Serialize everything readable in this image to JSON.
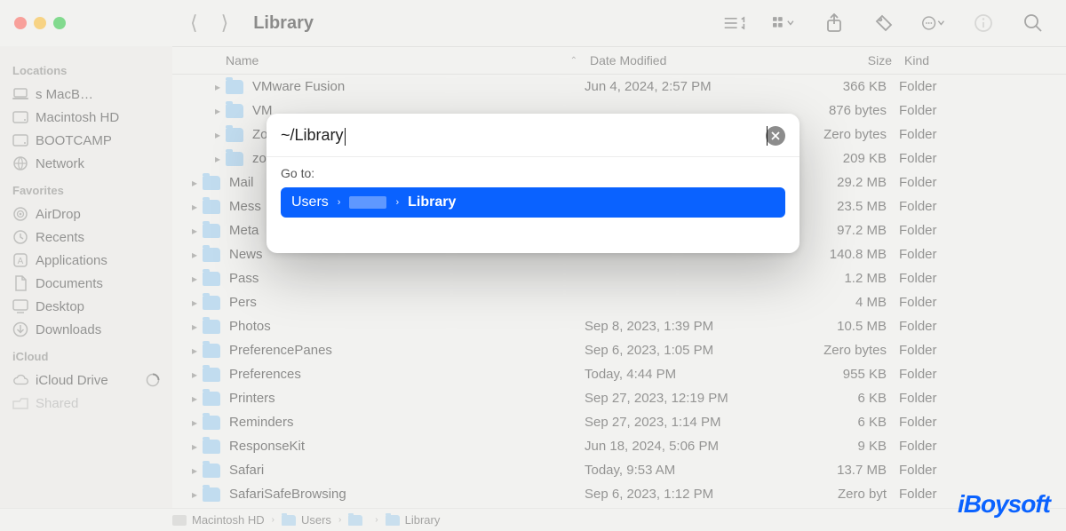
{
  "window": {
    "title": "Library"
  },
  "toolbar": {
    "back_disabled": true,
    "forward_disabled": true
  },
  "sidebar": {
    "sections": [
      {
        "label": "Locations",
        "items": [
          {
            "icon": "laptop-icon",
            "label": "s MacB…",
            "prefix_hidden": true
          },
          {
            "icon": "disk-icon",
            "label": "Macintosh HD"
          },
          {
            "icon": "disk-icon",
            "label": "BOOTCAMP"
          },
          {
            "icon": "globe-icon",
            "label": "Network"
          }
        ]
      },
      {
        "label": "Favorites",
        "items": [
          {
            "icon": "airdrop-icon",
            "label": "AirDrop"
          },
          {
            "icon": "clock-icon",
            "label": "Recents"
          },
          {
            "icon": "apps-icon",
            "label": "Applications"
          },
          {
            "icon": "doc-icon",
            "label": "Documents"
          },
          {
            "icon": "desktop-icon",
            "label": "Desktop"
          },
          {
            "icon": "download-icon",
            "label": "Downloads"
          }
        ]
      },
      {
        "label": "iCloud",
        "items": [
          {
            "icon": "cloud-icon",
            "label": "iCloud Drive",
            "trailing": "progress"
          },
          {
            "icon": "shared-icon",
            "label": "Shared",
            "faded": true
          }
        ]
      }
    ]
  },
  "columns": {
    "name": "Name",
    "date": "Date Modified",
    "size": "Size",
    "kind": "Kind",
    "sort": "name_asc"
  },
  "rows": [
    {
      "disclosure": true,
      "indent": 1,
      "name": "VMware Fusion",
      "date": "Jun 4, 2024, 2:57 PM",
      "size": "366 KB",
      "kind": "Folder"
    },
    {
      "disclosure": true,
      "indent": 1,
      "name": "VM",
      "date": "",
      "size": "876 bytes",
      "kind": "Folder"
    },
    {
      "disclosure": true,
      "indent": 1,
      "name": "Zo",
      "date": "",
      "size": "Zero bytes",
      "kind": "Folder"
    },
    {
      "disclosure": true,
      "indent": 1,
      "name": "zo",
      "date": "",
      "size": "209 KB",
      "kind": "Folder"
    },
    {
      "disclosure": true,
      "indent": 0,
      "name": "Mail",
      "date": "",
      "size": "29.2 MB",
      "kind": "Folder"
    },
    {
      "disclosure": true,
      "indent": 0,
      "name": "Mess",
      "date": "",
      "size": "23.5 MB",
      "kind": "Folder"
    },
    {
      "disclosure": true,
      "indent": 0,
      "name": "Meta",
      "date": "",
      "size": "97.2 MB",
      "kind": "Folder"
    },
    {
      "disclosure": true,
      "indent": 0,
      "name": "News",
      "date": "",
      "size": "140.8 MB",
      "kind": "Folder"
    },
    {
      "disclosure": true,
      "indent": 0,
      "name": "Pass",
      "date": "",
      "size": "1.2 MB",
      "kind": "Folder"
    },
    {
      "disclosure": true,
      "indent": 0,
      "name": "Pers",
      "date": "",
      "size": "4 MB",
      "kind": "Folder"
    },
    {
      "disclosure": true,
      "indent": 0,
      "name": "Photos",
      "date": "Sep 8, 2023, 1:39 PM",
      "size": "10.5 MB",
      "kind": "Folder"
    },
    {
      "disclosure": true,
      "indent": 0,
      "name": "PreferencePanes",
      "date": "Sep 6, 2023, 1:05 PM",
      "size": "Zero bytes",
      "kind": "Folder"
    },
    {
      "disclosure": true,
      "indent": 0,
      "name": "Preferences",
      "date": "Today, 4:44 PM",
      "size": "955 KB",
      "kind": "Folder"
    },
    {
      "disclosure": true,
      "indent": 0,
      "name": "Printers",
      "date": "Sep 27, 2023, 12:19 PM",
      "size": "6 KB",
      "kind": "Folder"
    },
    {
      "disclosure": true,
      "indent": 0,
      "name": "Reminders",
      "date": "Sep 27, 2023, 1:14 PM",
      "size": "6 KB",
      "kind": "Folder"
    },
    {
      "disclosure": true,
      "indent": 0,
      "name": "ResponseKit",
      "date": "Jun 18, 2024, 5:06 PM",
      "size": "9 KB",
      "kind": "Folder"
    },
    {
      "disclosure": true,
      "indent": 0,
      "name": "Safari",
      "date": "Today, 9:53 AM",
      "size": "13.7 MB",
      "kind": "Folder"
    },
    {
      "disclosure": true,
      "indent": 0,
      "name": "SafariSafeBrowsing",
      "date": "Sep 6, 2023, 1:12 PM",
      "size": "Zero byt",
      "kind": "Folder"
    }
  ],
  "pathbar": {
    "segments": [
      {
        "icon": "disk",
        "label": "Macintosh HD"
      },
      {
        "icon": "folder",
        "label": "Users"
      },
      {
        "icon": "folder",
        "label": ""
      },
      {
        "icon": "folder",
        "label": "Library"
      }
    ]
  },
  "goto": {
    "input": "~/Library",
    "label": "Go to:",
    "result": {
      "segments": [
        {
          "label": "Users"
        },
        {
          "label": "",
          "redacted": true
        },
        {
          "label": "Library",
          "bold": true
        }
      ]
    }
  },
  "watermark": "iBoysoft"
}
